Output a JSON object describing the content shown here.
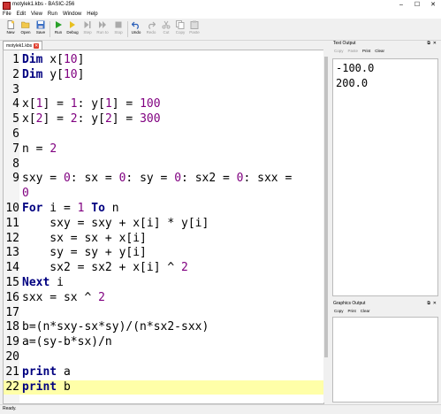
{
  "window": {
    "title": "motylek1.kbs - BASIC-256",
    "minimize": "–",
    "maximize": "☐",
    "close": "✕"
  },
  "menu": [
    "File",
    "Edit",
    "View",
    "Run",
    "Window",
    "Help"
  ],
  "toolbar": {
    "new": "New",
    "open": "Open",
    "save": "Save",
    "run": "Run",
    "debug": "Debug",
    "step": "Step",
    "run_to": "Run to",
    "stop": "Stop",
    "undo": "Undo",
    "redo": "Redo",
    "cut": "Cut",
    "copy": "Copy",
    "paste": "Paste"
  },
  "tab": {
    "name": "motylek1.kbs",
    "close": "✕"
  },
  "editor": {
    "current_line": 22,
    "lines": [
      {
        "n": "1",
        "text": "Dim x[10]"
      },
      {
        "n": "2",
        "text": "Dim y[10]"
      },
      {
        "n": "3",
        "text": ""
      },
      {
        "n": "4",
        "text": "x[1] = 1: y[1] = 100"
      },
      {
        "n": "5",
        "text": "x[2] = 2: y[2] = 300"
      },
      {
        "n": "6",
        "text": ""
      },
      {
        "n": "7",
        "text": "n = 2"
      },
      {
        "n": "8",
        "text": ""
      },
      {
        "n": "9",
        "text": "sxy = 0: sx = 0: sy = 0: sx2 = 0: sxx ="
      },
      {
        "n": "",
        "text": "0"
      },
      {
        "n": "10",
        "text": "For i = 1 To n"
      },
      {
        "n": "11",
        "text": "    sxy = sxy + x[i] * y[i]"
      },
      {
        "n": "12",
        "text": "    sx = sx + x[i]"
      },
      {
        "n": "13",
        "text": "    sy = sy + y[i]"
      },
      {
        "n": "14",
        "text": "    sx2 = sx2 + x[i] ^ 2"
      },
      {
        "n": "15",
        "text": "Next i"
      },
      {
        "n": "16",
        "text": "sxx = sx ^ 2"
      },
      {
        "n": "17",
        "text": ""
      },
      {
        "n": "18",
        "text": "b=(n*sxy-sx*sy)/(n*sx2-sxx)"
      },
      {
        "n": "19",
        "text": "a=(sy-b*sx)/n"
      },
      {
        "n": "20",
        "text": ""
      },
      {
        "n": "21",
        "text": "print a"
      },
      {
        "n": "22",
        "text": "print b"
      }
    ]
  },
  "text_output": {
    "title": "Text Output",
    "buttons": [
      "Copy",
      "Paste",
      "Print",
      "Clear"
    ],
    "lines": [
      "-100.0",
      "200.0"
    ]
  },
  "graphics_output": {
    "title": "Graphics Output",
    "buttons": [
      "Copy",
      "Print",
      "Clear"
    ]
  },
  "status": "Ready.",
  "colors": {
    "keyword": "#000080",
    "number": "#800080",
    "current_line": "#ffffa8"
  }
}
